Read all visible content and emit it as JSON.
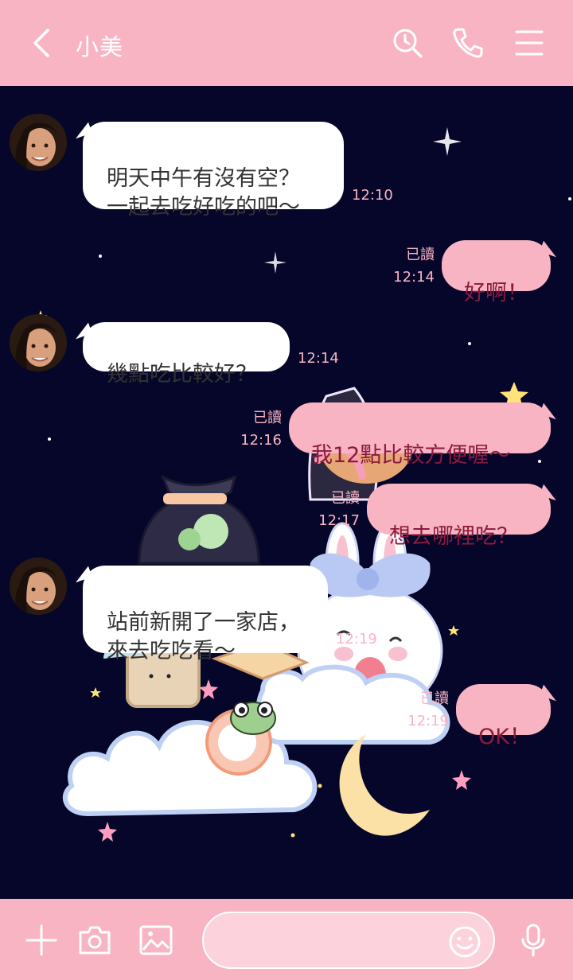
{
  "header": {
    "title": "小美",
    "back_icon": "chevron-left-icon",
    "search_icon": "search-icon",
    "call_icon": "phone-icon",
    "menu_icon": "menu-icon"
  },
  "messages": [
    {
      "side": "in",
      "text": "明天中午有沒有空？\n一起去吃好吃的吧～",
      "time": "12:10"
    },
    {
      "side": "out",
      "text": "好啊！",
      "read": "已讀",
      "time": "12:14"
    },
    {
      "side": "in",
      "text": "幾點吃比較好？",
      "time": "12:14"
    },
    {
      "side": "out",
      "text": "我12點比較方便喔～",
      "read": "已讀",
      "time": "12:16"
    },
    {
      "side": "out",
      "text": "想去哪裡吃？",
      "read": "已讀",
      "time": "12:17"
    },
    {
      "side": "in",
      "text": "站前新開了一家店，\n來去吃吃看～",
      "time": "12:19"
    },
    {
      "side": "out",
      "text": "OK！",
      "read": "已讀",
      "time": "12:19"
    }
  ],
  "footer": {
    "add_icon": "plus-icon",
    "camera_icon": "camera-icon",
    "image_icon": "image-icon",
    "input_value": "",
    "emoji_icon": "smiley-icon",
    "mic_icon": "microphone-icon"
  },
  "colors": {
    "accent": "#f9b4c3",
    "background": "#06062a",
    "outgoing_text": "#8a1a3e"
  }
}
